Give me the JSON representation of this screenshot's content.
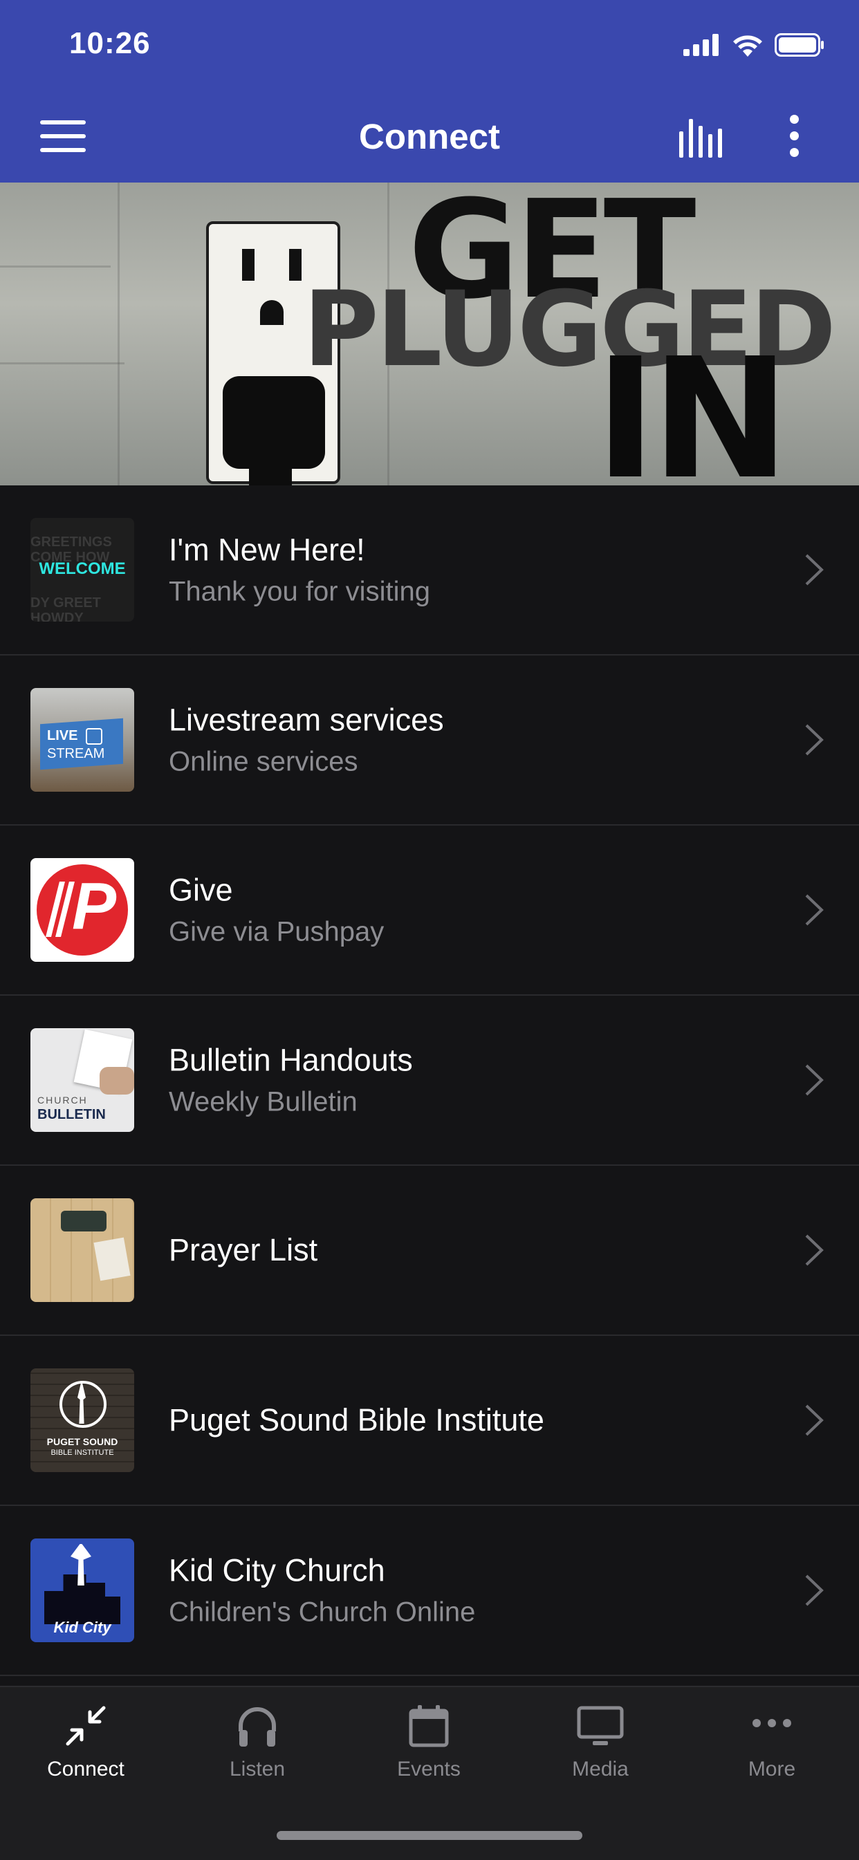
{
  "status_bar": {
    "time": "10:26"
  },
  "header": {
    "title": "Connect"
  },
  "colors": {
    "header": "#3a48ae",
    "background": "#141416",
    "tabbar": "#1e1e20",
    "subtitle": "#8d8d92"
  },
  "banner": {
    "line1": "GET",
    "line2": "PLUGGED",
    "line3": "IN"
  },
  "items": [
    {
      "title": "I'm New Here!",
      "subtitle": "Thank you for visiting",
      "thumb_text": "WELCOME"
    },
    {
      "title": "Livestream services",
      "subtitle": "Online services",
      "thumb_text_1": "LIVE",
      "thumb_text_2": "STREAM"
    },
    {
      "title": "Give",
      "subtitle": "Give via Pushpay",
      "thumb_text": "P"
    },
    {
      "title": "Bulletin Handouts",
      "subtitle": "Weekly Bulletin",
      "thumb_text_1": "CHURCH",
      "thumb_text_2": "BULLETIN"
    },
    {
      "title": "Prayer List",
      "subtitle": ""
    },
    {
      "title": "Puget Sound Bible Institute",
      "subtitle": "",
      "thumb_text_1": "PUGET SOUND",
      "thumb_text_2": "BIBLE INSTITUTE"
    },
    {
      "title": "Kid City Church",
      "subtitle": "Children's Church Online",
      "thumb_text": "Kid City"
    }
  ],
  "tabs": [
    {
      "label": "Connect",
      "icon": "compress-arrows-icon",
      "active": true
    },
    {
      "label": "Listen",
      "icon": "headphones-icon"
    },
    {
      "label": "Events",
      "icon": "calendar-icon"
    },
    {
      "label": "Media",
      "icon": "monitor-icon"
    },
    {
      "label": "More",
      "icon": "more-dots-icon"
    }
  ]
}
